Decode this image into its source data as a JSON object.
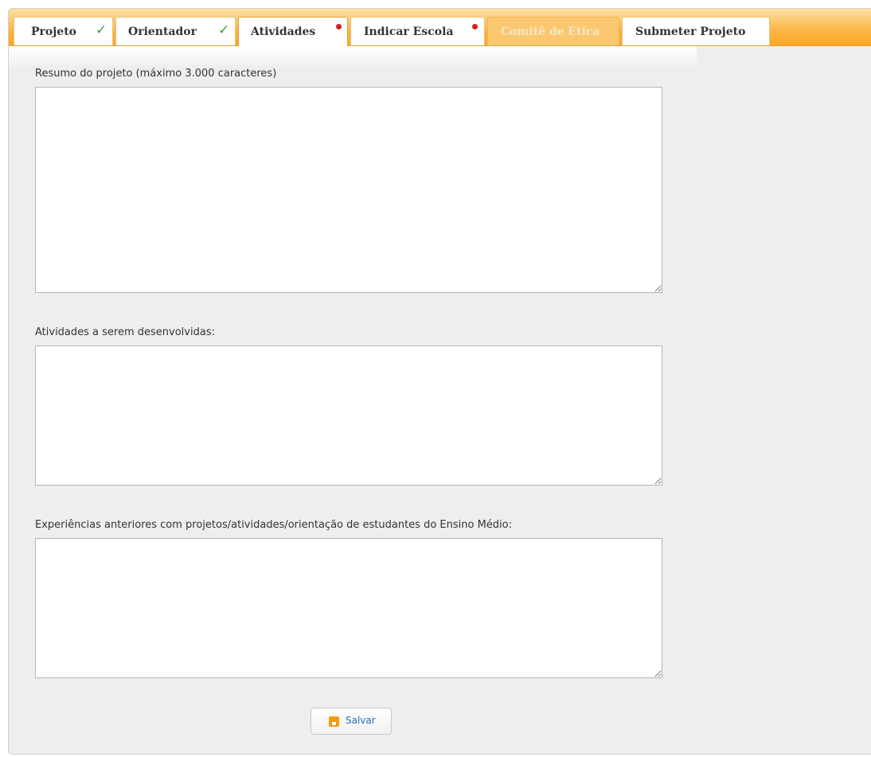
{
  "tabs": [
    {
      "label": "Projeto",
      "status": "complete",
      "status_symbol": "✓"
    },
    {
      "label": "Orientador",
      "status": "complete",
      "status_symbol": "✓"
    },
    {
      "label": "Atividades",
      "status": "pending",
      "active": true
    },
    {
      "label": "Indicar Escola",
      "status": "pending"
    },
    {
      "label": "Comitê de Ética",
      "status": "disabled"
    },
    {
      "label": "Submeter Projeto",
      "status": "none"
    }
  ],
  "form": {
    "resumo_label": "Resumo do projeto (máximo 3.000 caracteres)",
    "resumo_value": "",
    "atividades_label": "Atividades a serem desenvolvidas:",
    "atividades_value": "",
    "experiencias_label": "Experiências anteriores com projetos/atividades/orientação de estudantes do Ensino Médio:",
    "experiencias_value": ""
  },
  "actions": {
    "save_label": "Salvar",
    "save_icon": "save-icon"
  },
  "colors": {
    "tabbar_accent": "#f9a827",
    "check": "#3aa33a",
    "pending_dot": "#e01b1b",
    "save_text": "#2a6fb5"
  }
}
